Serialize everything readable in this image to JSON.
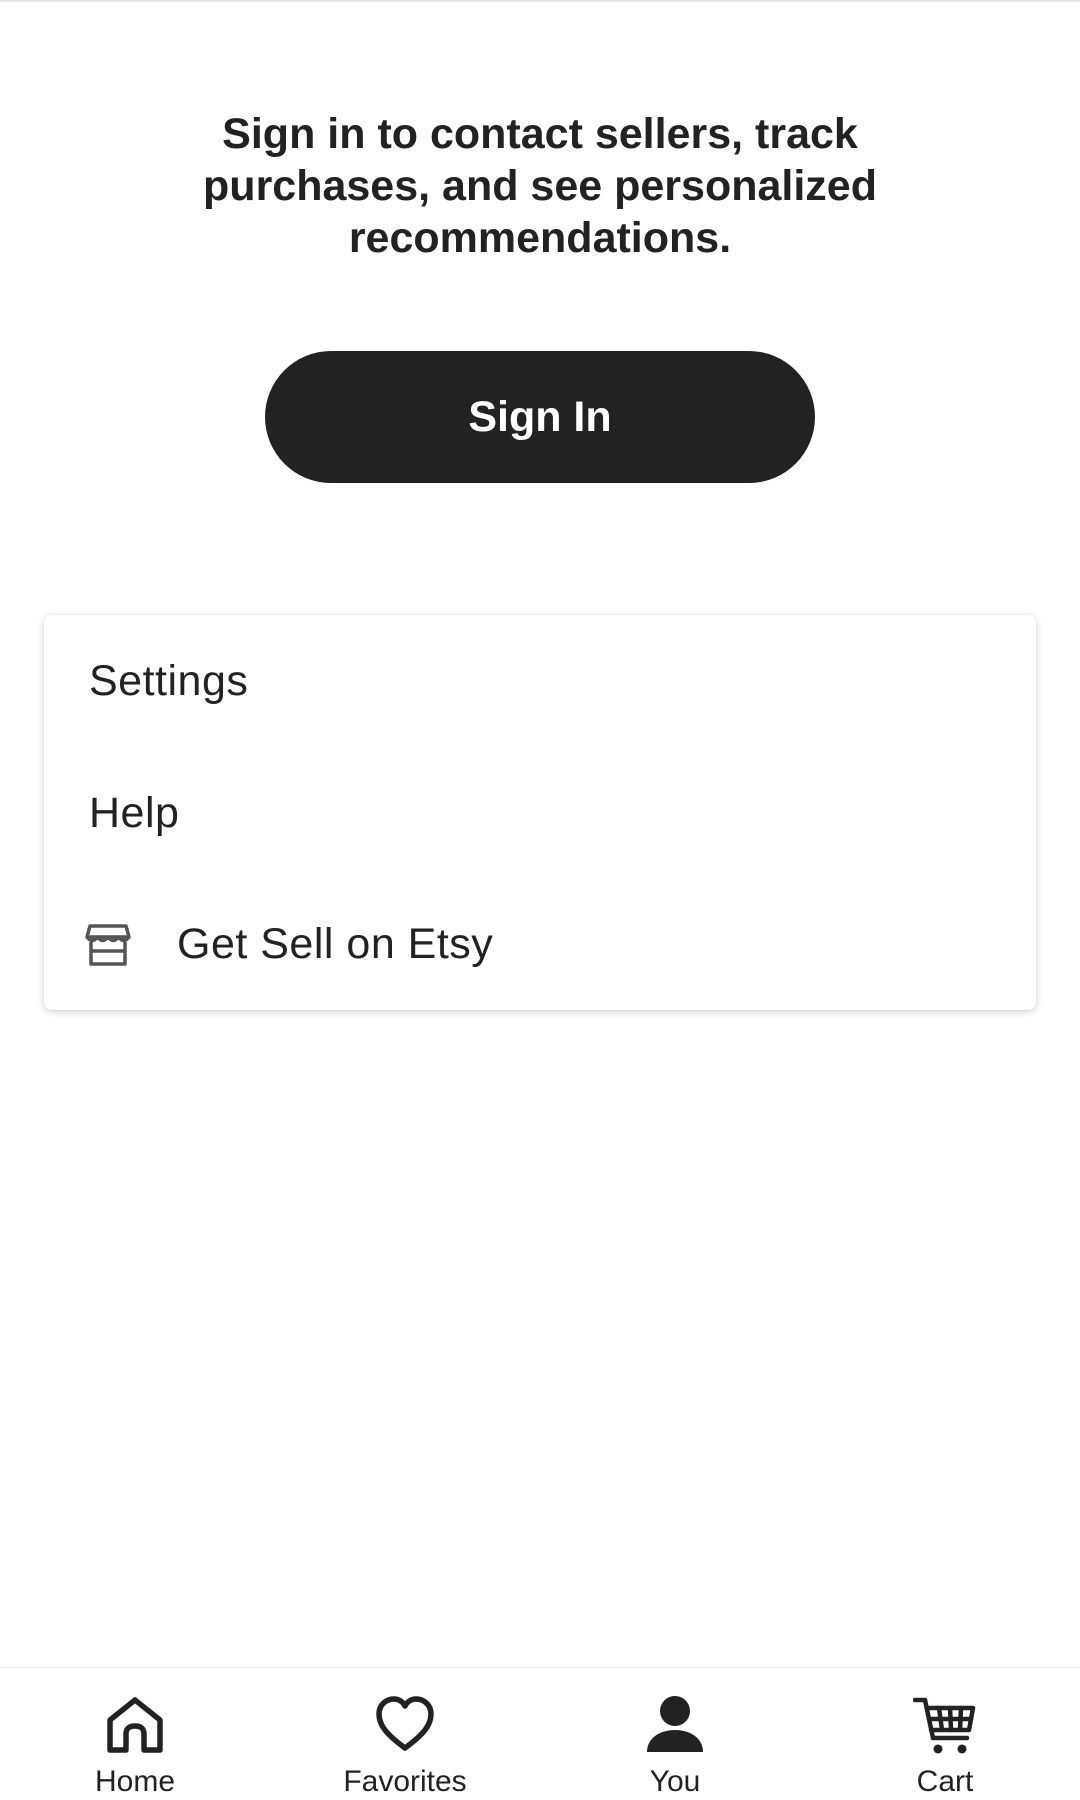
{
  "prompt": {
    "text": "Sign in to contact sellers, track purchases, and see personalized recommendations."
  },
  "signin": {
    "label": "Sign In"
  },
  "menu": {
    "items": [
      {
        "label": "Settings"
      },
      {
        "label": "Help"
      },
      {
        "label": "Get Sell on Etsy",
        "icon": "storefront-icon"
      }
    ]
  },
  "bottom_nav": {
    "items": [
      {
        "label": "Home",
        "icon": "home-icon"
      },
      {
        "label": "Favorites",
        "icon": "heart-icon"
      },
      {
        "label": "You",
        "icon": "person-icon",
        "active": true
      },
      {
        "label": "Cart",
        "icon": "cart-icon"
      }
    ]
  },
  "colors": {
    "text": "#222222",
    "button_bg": "#222222",
    "button_text": "#ffffff",
    "background": "#ffffff"
  }
}
